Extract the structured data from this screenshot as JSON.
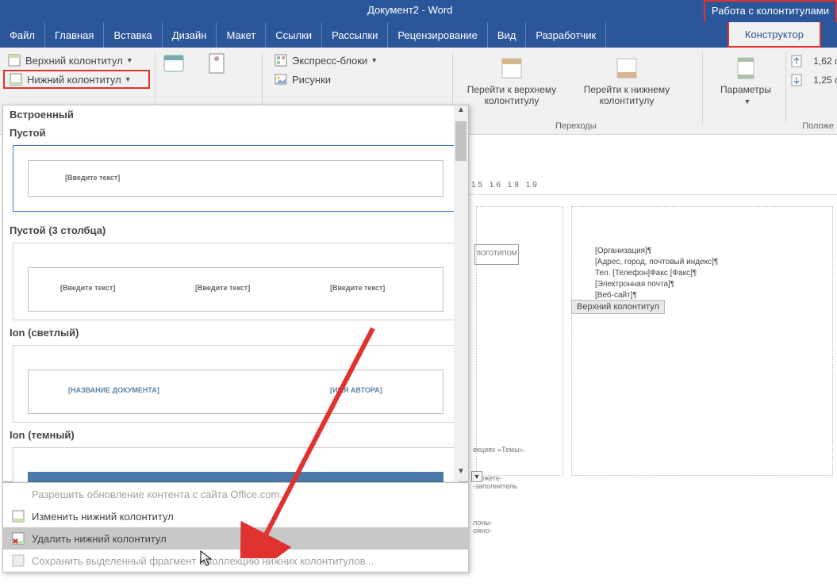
{
  "window": {
    "title": "Документ2 - Word",
    "context_tab": "Работа с колонтитулами"
  },
  "tabs": [
    "Файл",
    "Главная",
    "Вставка",
    "Дизайн",
    "Макет",
    "Ссылки",
    "Рассылки",
    "Рецензирование",
    "Вид",
    "Разработчик"
  ],
  "active_tab": "Конструктор",
  "hf_group": {
    "header": "Верхний колонтитул",
    "footer": "Нижний колонтитул"
  },
  "insert_group": {
    "quick_parts": "Экспресс-блоки",
    "pictures": "Рисунки"
  },
  "nav_group": {
    "go_header": "Перейти к верхнему колонтитулу",
    "go_footer": "Перейти к нижнему колонтитулу",
    "label": "Переходы"
  },
  "params_btn": "Параметры",
  "position": {
    "top": "1,62 с",
    "bottom": "1,25 с",
    "label": "Положе"
  },
  "gallery": {
    "heading": "Встроенный",
    "sections": [
      {
        "title": "Пустой",
        "placeholders": [
          "[Введите текст]"
        ]
      },
      {
        "title": "Пустой (3 столбца)",
        "placeholders": [
          "[Введите текст]",
          "[Введите текст]",
          "[Введите текст]"
        ]
      },
      {
        "title": "Ion (светлый)",
        "placeholders": [
          "[НАЗВАНИЕ ДОКУМЕНТА]",
          "[ИМЯ АВТОРА]"
        ]
      },
      {
        "title": "Ion (темный)",
        "placeholders": []
      }
    ]
  },
  "menu": {
    "allow_update": "Разрешить обновление контента с сайта Office.com...",
    "edit_footer": "Изменить нижний колонтитул",
    "delete_footer": "Удалить нижний колонтитул",
    "save_selection": "Сохранить выделенный фрагмент в коллекцию нижних колонтитулов..."
  },
  "doc": {
    "ruler": "15  16      18  19",
    "logo": "ЛОГОТИПОМ",
    "hdr_lines": [
      "[Организация]¶",
      "[Адрес, город, почтовый индекс]¶",
      "Тел. [Телефон]Факс [Факс]¶",
      "[Электронная почта]¶",
      "[Веб-сайт]¶"
    ],
    "hdr_badge": "Верхний колонтитул",
    "snippet1": "екциях «Темы».",
    "snippet2": "-можете-\n-заполнитель",
    "snippet3": "лоны-\nожно-"
  }
}
